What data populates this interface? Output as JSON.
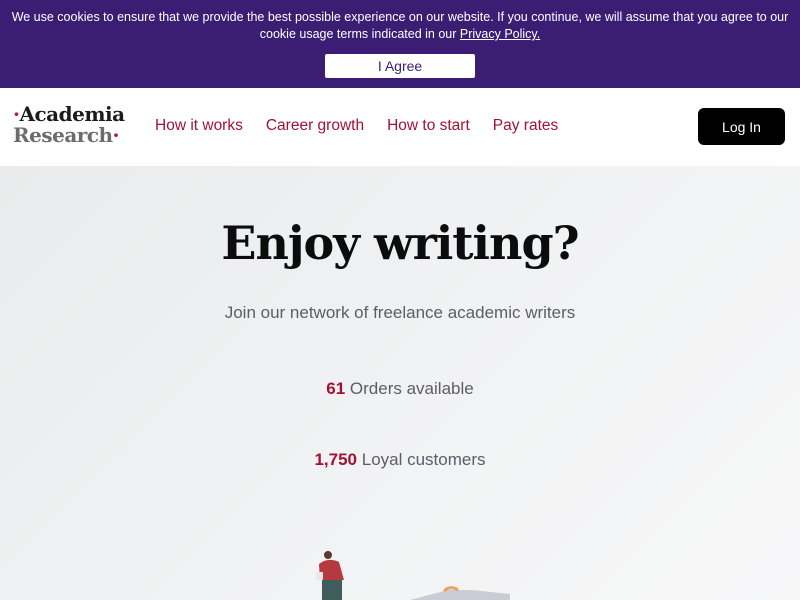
{
  "cookie_banner": {
    "text": "We use cookies to ensure that we provide the best possible experience on our website. If you continue, we will assume that you agree to our cookie usage terms indicated in our ",
    "link_label": "Privacy Policy.",
    "button_label": "I Agree"
  },
  "header": {
    "logo_line1": "Academia",
    "logo_line2": "Research",
    "nav": [
      "How it works",
      "Career growth",
      "How to start",
      "Pay rates"
    ],
    "login_label": "Log In"
  },
  "hero": {
    "title": "Enjoy writing?",
    "subtitle": "Join our network of freelance academic writers",
    "stats": [
      {
        "value": "61",
        "label": " Orders available"
      },
      {
        "value": "1,750",
        "label": " Loyal customers"
      }
    ]
  },
  "colors": {
    "banner": "#3b1e74",
    "accent": "#a31232",
    "login_button": "#000000"
  }
}
